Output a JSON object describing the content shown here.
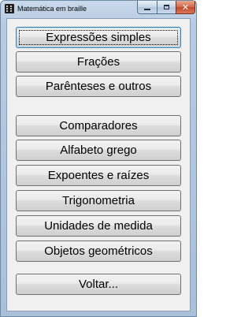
{
  "window": {
    "title": "Matemática em braille",
    "colors": {
      "frame": "#b7cbe0",
      "client": "#f0f0f0",
      "close": "#c2482a",
      "focus_border": "#3c7fb1"
    }
  },
  "icons": {
    "app": "braille-app-icon",
    "minimize": "minimize-icon",
    "maximize": "maximize-icon",
    "close": "close-icon"
  },
  "caption_buttons": {
    "close_glyph": "✕"
  },
  "menu": {
    "group1": [
      "Expressões simples",
      "Frações",
      "Parênteses e outros"
    ],
    "group2": [
      "Comparadores",
      "Alfabeto grego",
      "Expoentes e raízes",
      "Trigonometria",
      "Unidades de medida",
      "Objetos geométricos"
    ],
    "group3": [
      "Voltar..."
    ],
    "focused": "Expressões simples"
  }
}
